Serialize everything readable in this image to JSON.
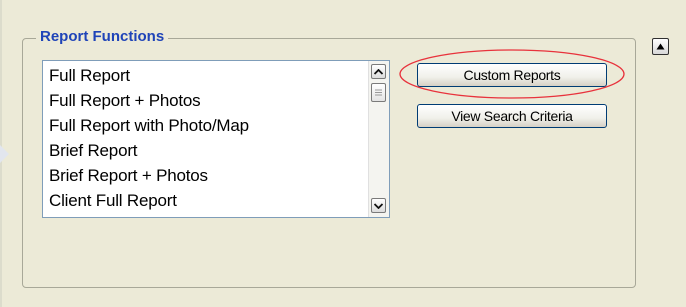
{
  "group": {
    "title": "Report Functions"
  },
  "report_list": {
    "items": [
      "Full Report",
      "Full Report + Photos",
      "Full Report with Photo/Map",
      "Brief Report",
      "Brief Report + Photos",
      "Client Full Report"
    ]
  },
  "buttons": {
    "custom_reports": "Custom Reports",
    "view_search_criteria": "View Search Criteria"
  },
  "icons": {
    "scroll_up": "scroll-up-arrow-icon",
    "scroll_down": "scroll-down-arrow-icon",
    "scroll_thumb_grip": "grip-icon",
    "collapse": "triangle-up-icon",
    "side_arrow": "arrow-right-icon"
  },
  "colors": {
    "panel_background": "#ecead7",
    "group_title": "#1f44b8",
    "highlight_ellipse": "#e8323c",
    "button_border": "#003c74"
  }
}
